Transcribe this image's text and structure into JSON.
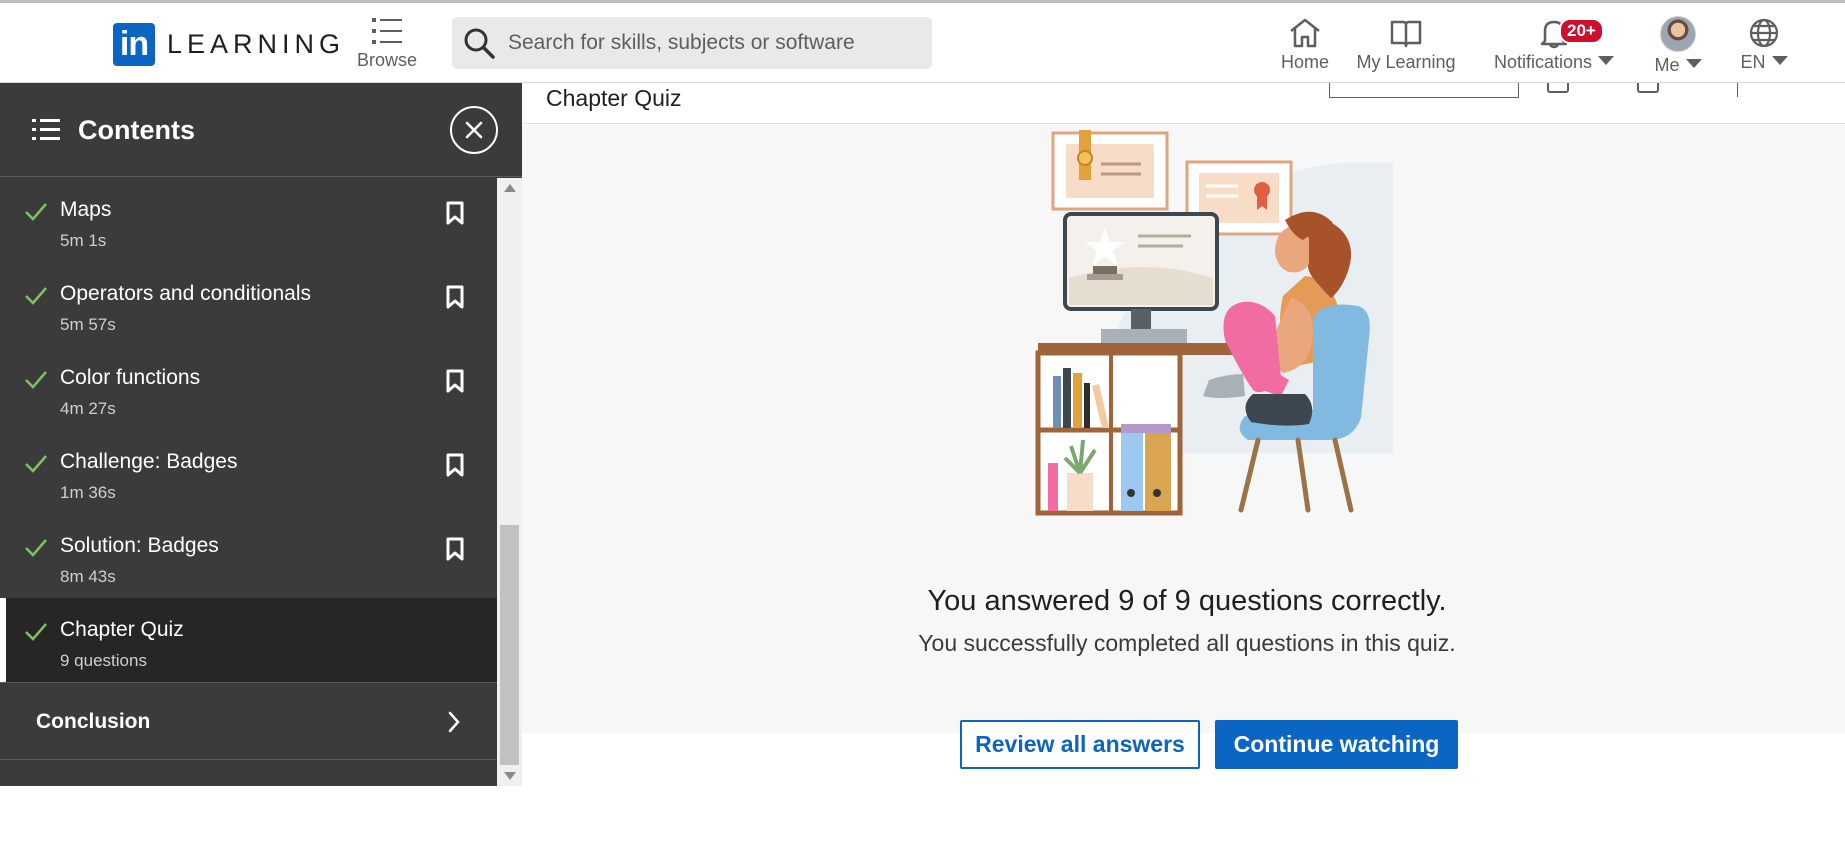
{
  "header": {
    "logo_in": "in",
    "logo_word": "LEARNING",
    "browse_label": "Browse",
    "search_placeholder": "Search for skills, subjects or software",
    "nav": {
      "home": "Home",
      "my_learning": "My Learning",
      "notifications": "Notifications",
      "notifications_badge": "20+",
      "me": "Me",
      "language": "EN"
    }
  },
  "sidebar": {
    "title": "Contents",
    "items": [
      {
        "title": "Maps",
        "meta": "5m 1s",
        "completed": true,
        "bookmarkable": true
      },
      {
        "title": "Operators and conditionals",
        "meta": "5m 57s",
        "completed": true,
        "bookmarkable": true
      },
      {
        "title": "Color functions",
        "meta": "4m 27s",
        "completed": true,
        "bookmarkable": true
      },
      {
        "title": "Challenge: Badges",
        "meta": "1m 36s",
        "completed": true,
        "bookmarkable": true
      },
      {
        "title": "Solution: Badges",
        "meta": "8m 43s",
        "completed": true,
        "bookmarkable": true
      },
      {
        "title": "Chapter Quiz",
        "meta": "9 questions",
        "completed": true,
        "bookmarkable": false,
        "active": true
      }
    ],
    "section": {
      "title": "Conclusion"
    }
  },
  "main": {
    "title": "Chapter Quiz",
    "result_title": "You answered 9 of 9 questions correctly.",
    "result_subtitle": "You successfully completed all questions in this quiz.",
    "review_button": "Review all answers",
    "continue_button": "Continue watching"
  },
  "colors": {
    "brand_blue": "#0a66c2",
    "sidebar_bg": "#3b3b3b",
    "active_item_bg": "#262626",
    "check_green": "#7fc15e",
    "badge_red": "#cb112d"
  },
  "icons": {
    "browse": "grid-list-icon",
    "search": "search-icon",
    "home": "home-icon",
    "my_learning": "book-icon",
    "notifications": "bell-icon",
    "language": "globe-icon",
    "contents": "list-icon",
    "close": "close-icon",
    "completed": "check-icon",
    "bookmark": "bookmark-icon",
    "section": "chevron-right-icon"
  }
}
